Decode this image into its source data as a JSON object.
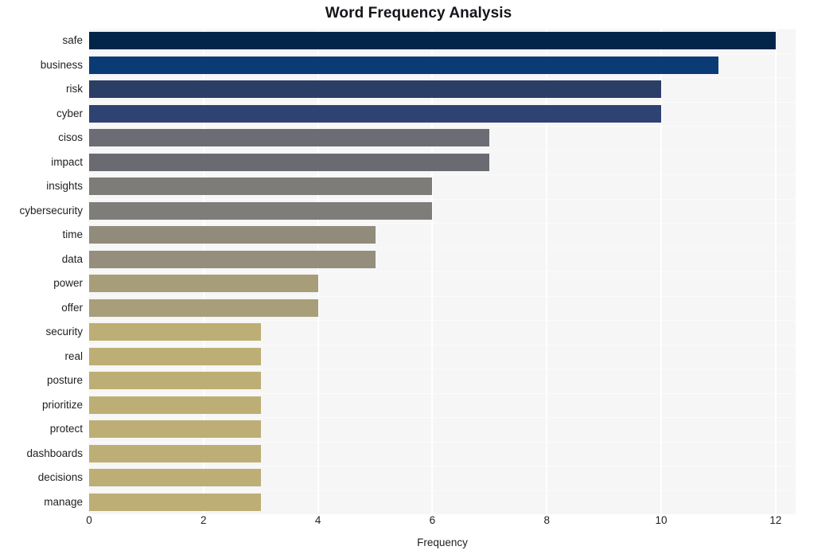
{
  "chart_data": {
    "type": "bar",
    "orientation": "horizontal",
    "title": "Word Frequency Analysis",
    "xlabel": "Frequency",
    "ylabel": "",
    "categories": [
      "safe",
      "business",
      "risk",
      "cyber",
      "cisos",
      "impact",
      "insights",
      "cybersecurity",
      "time",
      "data",
      "power",
      "offer",
      "security",
      "real",
      "posture",
      "prioritize",
      "protect",
      "dashboards",
      "decisions",
      "manage"
    ],
    "values": [
      12,
      11,
      10,
      10,
      7,
      7,
      6,
      6,
      5,
      5,
      4,
      4,
      3,
      3,
      3,
      3,
      3,
      3,
      3,
      3
    ],
    "bar_colors": [
      "#04254a",
      "#0a3b75",
      "#2b3f66",
      "#2e4273",
      "#6b6c74",
      "#696a72",
      "#7d7c78",
      "#7e7d79",
      "#918b7b",
      "#958e7d",
      "#a79d79",
      "#a89e7a",
      "#bdae75",
      "#bdae75",
      "#bdae75",
      "#bdae75",
      "#bdae75",
      "#bdae75",
      "#bdae75",
      "#bdae75"
    ],
    "xlim": [
      0,
      12.35
    ],
    "xticks": [
      0,
      2,
      4,
      6,
      8,
      10,
      12
    ],
    "xtick_labels": [
      "0",
      "2",
      "4",
      "6",
      "8",
      "10",
      "12"
    ],
    "grid": true,
    "grid_orientation": "vertical",
    "legend": null,
    "plot_background": "#f6f6f7",
    "figure_background": "#ffffff",
    "gridline_color": "#ffffff",
    "text_color": "#1d1f22",
    "title_color": "#14161a"
  }
}
